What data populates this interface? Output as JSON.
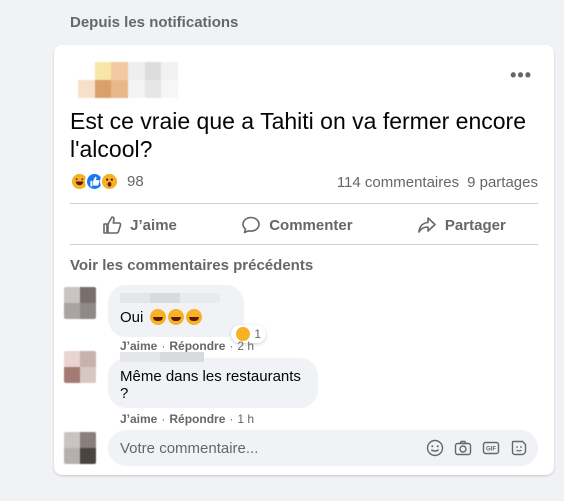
{
  "section_label": "Depuis les notifications",
  "post": {
    "text": "Est ce vraie que a Tahiti on va fermer encore l'alcool?",
    "reaction_count": "98",
    "reaction_icons": [
      "haha-icon",
      "like-icon",
      "wow-icon"
    ],
    "comments_count": "114 commentaires",
    "shares_count": "9 partages",
    "more_label": "•••"
  },
  "actions": {
    "like": "J’aime",
    "comment": "Commenter",
    "share": "Partager"
  },
  "comments_section": {
    "previous_label": "Voir les commentaires précédents",
    "comments": [
      {
        "text": "Oui",
        "reaction_count": "1",
        "like": "J’aime",
        "reply": "Répondre",
        "time": "2 h"
      },
      {
        "text": "Même dans les restaurants ?",
        "like": "J’aime",
        "reply": "Répondre",
        "time": "1 h"
      }
    ]
  },
  "composer": {
    "placeholder": "Votre commentaire..."
  },
  "colors": {
    "background": "#f0f2f5",
    "card": "#ffffff",
    "secondary_text": "#65676b",
    "like_blue": "#1877f2",
    "reaction_yellow": "#f7b125"
  }
}
